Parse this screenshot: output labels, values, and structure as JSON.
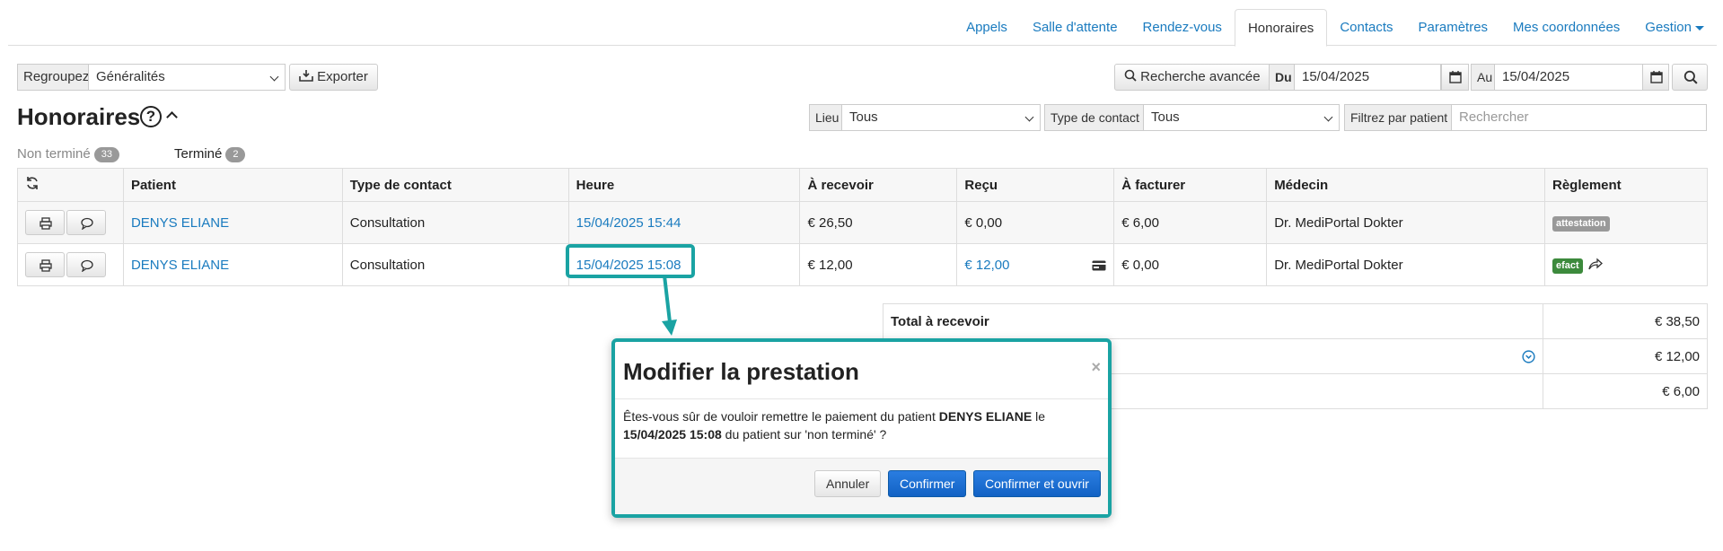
{
  "nav": {
    "items": [
      "Appels",
      "Salle d'attente",
      "Rendez-vous",
      "Honoraires",
      "Contacts",
      "Paramètres",
      "Mes coordonnées",
      "Gestion"
    ],
    "active": "Honoraires"
  },
  "toolbar": {
    "group_label": "Regroupez",
    "group_value": "Généralités",
    "export_label": "Exporter",
    "advanced_search_label": "Recherche avancée",
    "from_label": "Du",
    "from_value": "15/04/2025",
    "to_label": "Au",
    "to_value": "15/04/2025"
  },
  "page": {
    "title": "Honoraires",
    "help_glyph": "?"
  },
  "filters": {
    "place_label": "Lieu",
    "place_value": "Tous",
    "contact_type_label": "Type de contact",
    "contact_type_value": "Tous",
    "patient_filter_label": "Filtrez par patient",
    "patient_search_placeholder": "Rechercher"
  },
  "status_tabs": [
    {
      "label": "Non terminé",
      "count": "33"
    },
    {
      "label": "Terminé",
      "count": "2"
    }
  ],
  "table": {
    "headers": [
      "Patient",
      "Type de contact",
      "Heure",
      "À recevoir",
      "Reçu",
      "À facturer",
      "Médecin",
      "Règlement"
    ],
    "rows": [
      {
        "patient": "DENYS ELIANE",
        "type": "Consultation",
        "heure": "15/04/2025 15:44",
        "a_recevoir": "€ 26,50",
        "recu": "€ 0,00",
        "a_facturer": "€ 6,00",
        "medecin": "Dr. MediPortal Dokter",
        "reglement": "attestation"
      },
      {
        "patient": "DENYS ELIANE",
        "type": "Consultation",
        "heure": "15/04/2025 15:08",
        "a_recevoir": "€ 12,00",
        "recu": "€ 12,00",
        "a_facturer": "€ 0,00",
        "medecin": "Dr. MediPortal Dokter",
        "reglement": "efact"
      }
    ]
  },
  "totals": {
    "label_receive": "Total à recevoir",
    "amounts": [
      "€ 38,50",
      "€ 12,00",
      "€ 6,00"
    ]
  },
  "modal": {
    "title": "Modifier la prestation",
    "close": "×",
    "text_1": "Êtes-vous sûr de vouloir remettre le paiement du patient ",
    "patient": "DENYS ELIANE",
    "text_2": " le ",
    "datetime": "15/04/2025 15:08",
    "text_3": " du patient sur 'non terminé' ?",
    "cancel": "Annuler",
    "confirm": "Confirmer",
    "confirm_open": "Confirmer et ouvrir"
  },
  "colors": {
    "link": "#1a7bbf",
    "highlight": "#1aa3a3",
    "primary": "#1262c4",
    "label_grey": "#999999",
    "label_green": "#3c8a3c"
  }
}
